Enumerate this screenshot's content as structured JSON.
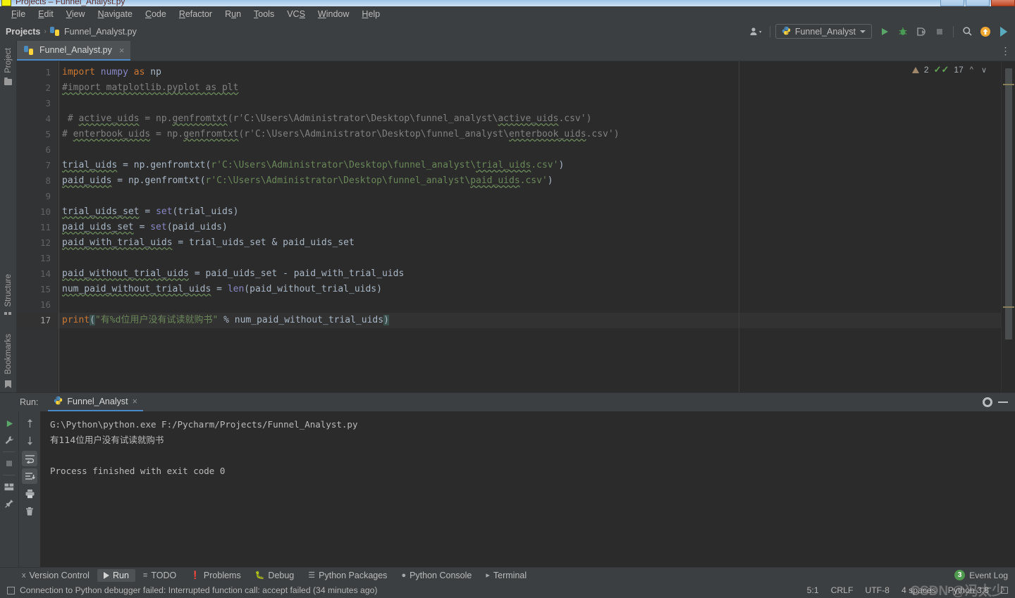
{
  "window": {
    "title": "Projects – Funnel_Analyst.py",
    "app_icon": "pycharm-icon",
    "controls": [
      "minimize",
      "maximize",
      "close"
    ]
  },
  "menubar": {
    "items": [
      {
        "label": "File",
        "mnemonic": "F"
      },
      {
        "label": "Edit",
        "mnemonic": "E"
      },
      {
        "label": "View",
        "mnemonic": "V"
      },
      {
        "label": "Navigate",
        "mnemonic": "N"
      },
      {
        "label": "Code",
        "mnemonic": "C"
      },
      {
        "label": "Refactor",
        "mnemonic": "R"
      },
      {
        "label": "Run",
        "mnemonic": "u"
      },
      {
        "label": "Tools",
        "mnemonic": "T"
      },
      {
        "label": "VCS",
        "mnemonic": "S"
      },
      {
        "label": "Window",
        "mnemonic": "W"
      },
      {
        "label": "Help",
        "mnemonic": "H"
      }
    ]
  },
  "navbar": {
    "breadcrumb": [
      {
        "label": "Projects",
        "icon": ""
      },
      {
        "label": "Funnel_Analyst.py",
        "icon": "python-file-icon"
      }
    ],
    "separator": "›",
    "run_config": {
      "label": "Funnel_Analyst",
      "icon": "python-icon"
    },
    "buttons": [
      {
        "name": "user-account",
        "icon": "person-icon"
      },
      {
        "name": "run",
        "icon": "run-icon"
      },
      {
        "name": "debug",
        "icon": "debug-icon"
      },
      {
        "name": "run-with-coverage",
        "icon": "coverage-icon"
      },
      {
        "name": "stop",
        "icon": "stop-icon"
      },
      {
        "name": "search-everywhere",
        "icon": "search-icon"
      },
      {
        "name": "updates",
        "icon": "update-arrow-icon"
      },
      {
        "name": "ide-features",
        "icon": "feature-trainer-icon"
      }
    ]
  },
  "left_toolbar": {
    "top": [
      {
        "label": "Project",
        "icon": "folder-icon"
      }
    ],
    "bottom": [
      {
        "label": "Structure",
        "icon": "structure-icon"
      },
      {
        "label": "Bookmarks",
        "icon": "bookmark-icon"
      }
    ]
  },
  "editor": {
    "tabs": [
      {
        "label": "Funnel_Analyst.py",
        "icon": "python-file-icon",
        "active": true,
        "close": "×"
      }
    ],
    "overflow": "⋮",
    "inspection": {
      "warning_count": "2",
      "ok_count": "17",
      "warn_icon": "warning-triangle-icon",
      "ok_icon": "green-check-icon"
    },
    "current_line": 17,
    "lines": [
      {
        "n": 1,
        "fold": "",
        "text": "import numpy as np"
      },
      {
        "n": 2,
        "fold": "tri",
        "text": "#import matplotlib.pyplot as plt"
      },
      {
        "n": 3,
        "fold": "",
        "text": ""
      },
      {
        "n": 4,
        "fold": "",
        "text": " # active_uids = np.genfromtxt(r'C:\\Users\\Administrator\\Desktop\\funnel_analyst\\active_uids.csv')"
      },
      {
        "n": 5,
        "fold": "minus",
        "text": "# enterbook_uids = np.genfromtxt(r'C:\\Users\\Administrator\\Desktop\\funnel_analyst\\enterbook_uids.csv')"
      },
      {
        "n": 6,
        "fold": "",
        "text": ""
      },
      {
        "n": 7,
        "fold": "",
        "text": "trial_uids = np.genfromtxt(r'C:\\Users\\Administrator\\Desktop\\funnel_analyst\\trial_uids.csv')"
      },
      {
        "n": 8,
        "fold": "",
        "text": "paid_uids = np.genfromtxt(r'C:\\Users\\Administrator\\Desktop\\funnel_analyst\\paid_uids.csv')"
      },
      {
        "n": 9,
        "fold": "",
        "text": ""
      },
      {
        "n": 10,
        "fold": "",
        "text": "trial_uids_set = set(trial_uids)"
      },
      {
        "n": 11,
        "fold": "",
        "text": "paid_uids_set = set(paid_uids)"
      },
      {
        "n": 12,
        "fold": "",
        "text": "paid_with_trial_uids = trial_uids_set & paid_uids_set"
      },
      {
        "n": 13,
        "fold": "",
        "text": ""
      },
      {
        "n": 14,
        "fold": "",
        "text": "paid_without_trial_uids = paid_uids_set - paid_with_trial_uids"
      },
      {
        "n": 15,
        "fold": "",
        "text": "num_paid_without_trial_uids = len(paid_without_trial_uids)"
      },
      {
        "n": 16,
        "fold": "",
        "text": ""
      },
      {
        "n": 17,
        "fold": "",
        "text": "print(\"有%d位用户没有试读就购书\" % num_paid_without_trial_uids)"
      }
    ]
  },
  "run_window": {
    "label": "Run:",
    "tab": {
      "label": "Funnel_Analyst",
      "icon": "python-icon",
      "close": "×"
    },
    "header_buttons": [
      {
        "name": "settings",
        "icon": "gear-icon"
      },
      {
        "name": "hide",
        "icon": "minimize-icon"
      }
    ],
    "toolbar_left": [
      {
        "name": "rerun",
        "icon": "run-icon"
      },
      {
        "name": "edit-configurations",
        "icon": "wrench-icon"
      },
      {
        "name": "stop",
        "icon": "stop-icon"
      },
      {
        "name": "layout",
        "icon": "layout-icon"
      },
      {
        "name": "pin-tab",
        "icon": "pin-icon"
      }
    ],
    "toolbar_right": [
      {
        "name": "up-the-stack",
        "icon": "arrow-up-icon"
      },
      {
        "name": "down-the-stack",
        "icon": "arrow-down-icon"
      },
      {
        "name": "soft-wrap",
        "icon": "soft-wrap-icon"
      },
      {
        "name": "scroll-to-end",
        "icon": "scroll-end-icon"
      },
      {
        "name": "print",
        "icon": "printer-icon"
      },
      {
        "name": "clear-all",
        "icon": "trash-icon"
      }
    ],
    "console": [
      "G:\\Python\\python.exe F:/Pycharm/Projects/Funnel_Analyst.py",
      "有114位用户没有试读就购书",
      "",
      "Process finished with exit code 0"
    ]
  },
  "bottom_bar": {
    "tabs": [
      {
        "label": "Version Control",
        "icon": "branch-icon",
        "active": false
      },
      {
        "label": "Run",
        "icon": "run-icon",
        "active": true
      },
      {
        "label": "TODO",
        "icon": "todo-icon",
        "active": false
      },
      {
        "label": "Problems",
        "icon": "problems-icon",
        "active": false
      },
      {
        "label": "Debug",
        "icon": "debug-icon",
        "active": false
      },
      {
        "label": "Python Packages",
        "icon": "packages-icon",
        "active": false
      },
      {
        "label": "Python Console",
        "icon": "python-console-icon",
        "active": false
      },
      {
        "label": "Terminal",
        "icon": "terminal-icon",
        "active": false
      }
    ]
  },
  "status_bar": {
    "message": "Connection to Python debugger failed: Interrupted function call: accept failed (34 minutes ago)",
    "message_icon": "message-icon",
    "caret_position": "5:1",
    "line_separator": "CRLF",
    "encoding": "UTF-8",
    "indent": "4 spaces",
    "interpreter": "Python 3.8",
    "lock_icon": "lock-icon",
    "event_log": {
      "label": "Event Log",
      "count": "3"
    }
  },
  "watermark": "CSDN @冯太少",
  "colors": {
    "accent_blue": "#4a88c7",
    "run_green": "#5aa85a",
    "keyword_orange": "#cc7832",
    "string_green": "#6a8759",
    "comment_gray": "#808080",
    "editor_bg": "#2b2b2b",
    "panel_bg": "#3c3f41"
  }
}
